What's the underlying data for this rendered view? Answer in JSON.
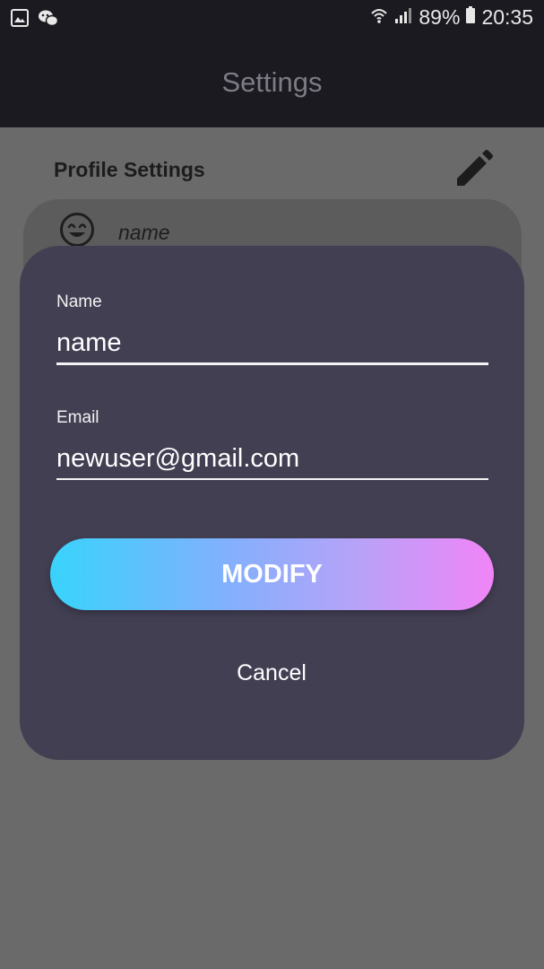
{
  "status_bar": {
    "left_icons": [
      "gallery-icon",
      "wechat-icon"
    ],
    "wifi_icon": "wifi-icon",
    "signal_icon": "signal-icon",
    "battery_percent": "89%",
    "battery_icon": "battery-icon",
    "time": "20:35"
  },
  "app_bar": {
    "title": "Settings"
  },
  "profile": {
    "section_title": "Profile Settings",
    "edit_icon": "pencil-icon",
    "avatar_icon": "smiley-icon",
    "name": "name"
  },
  "dialog": {
    "name_label": "Name",
    "name_value": "name",
    "email_label": "Email",
    "email_value": "newuser@gmail.com",
    "modify_label": "MODIFY",
    "cancel_label": "Cancel"
  },
  "colors": {
    "status_bar_bg": "#1b1a20",
    "app_bar_bg": "#1b1a20",
    "scrim_bg": "#6a6a6a",
    "dialog_bg": "#423f53",
    "gradient_start": "#38d3fb",
    "gradient_end": "#f184f7"
  }
}
